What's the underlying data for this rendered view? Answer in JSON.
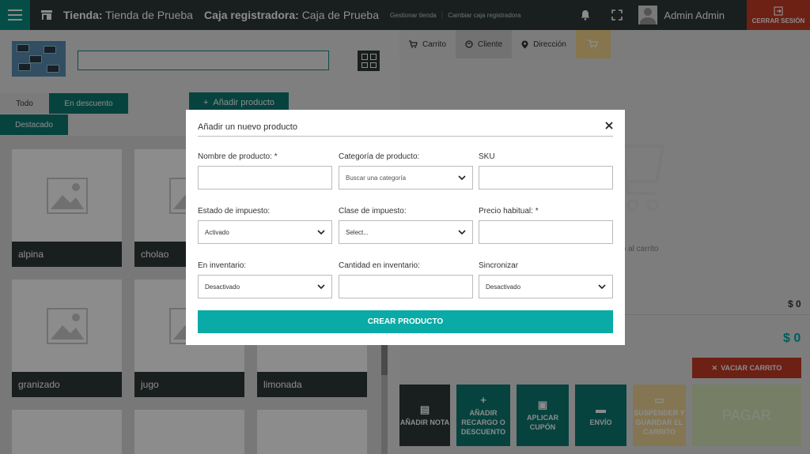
{
  "topbar": {
    "store_label": "Tienda:",
    "store_name": "Tienda de Prueba",
    "register_label": "Caja registradora:",
    "register_name": "Caja de Prueba",
    "link_manage_store": "Gestionar tienda",
    "link_change_register": "Cambiar caja registradora",
    "user_name": "Admin Admin",
    "logout_label": "CERRAR SESIÓN"
  },
  "filters": {
    "all": "Todo",
    "discount": "En descuento",
    "featured": "Destacado",
    "add_product": "Añadir producto"
  },
  "products": [
    {
      "name": "alpina"
    },
    {
      "name": "cholao"
    },
    {
      "name": "granizado"
    },
    {
      "name": "jugo"
    },
    {
      "name": "limonada"
    }
  ],
  "right_panel": {
    "tabs": [
      "Carrito",
      "Cliente",
      "Dirección"
    ],
    "empty_text": "to al carrito",
    "subtotal": "$ 0",
    "total": "$ 0",
    "clear_cart": "VACIAR CARRITO",
    "actions": {
      "note": "AÑADIR NOTA",
      "surcharge": "AÑADIR RECARGO O DESCUENTO",
      "coupon": "APLICAR CUPÓN",
      "shipping": "ENVÍO",
      "suspend": "SUSPENDER Y GUARDAR EL CARRITO",
      "pay": "PAGAR"
    }
  },
  "modal": {
    "title": "Añadir un nuevo producto",
    "fields": {
      "name_label": "Nombre de producto: *",
      "name_value": "",
      "category_label": "Categoría de producto:",
      "category_placeholder": "Buscar una categoría",
      "sku_label": "SKU",
      "sku_value": "",
      "tax_status_label": "Estado de impuesto:",
      "tax_status_value": "Activado",
      "tax_class_label": "Clase de impuesto:",
      "tax_class_value": "Select...",
      "regular_price_label": "Precio habitual: *",
      "regular_price_value": "",
      "inventory_label": "En inventario:",
      "inventory_value": "Desactivado",
      "stock_qty_label": "Cantidad en inventario:",
      "stock_qty_value": "",
      "sync_label": "Sincronizar",
      "sync_value": "Desactivado"
    },
    "create_button": "CREAR PRODUCTO"
  },
  "colors": {
    "topbar": "#2f3a38",
    "accent": "#0d7b72",
    "create_button": "#0aaaa6",
    "danger": "#c63b26"
  }
}
